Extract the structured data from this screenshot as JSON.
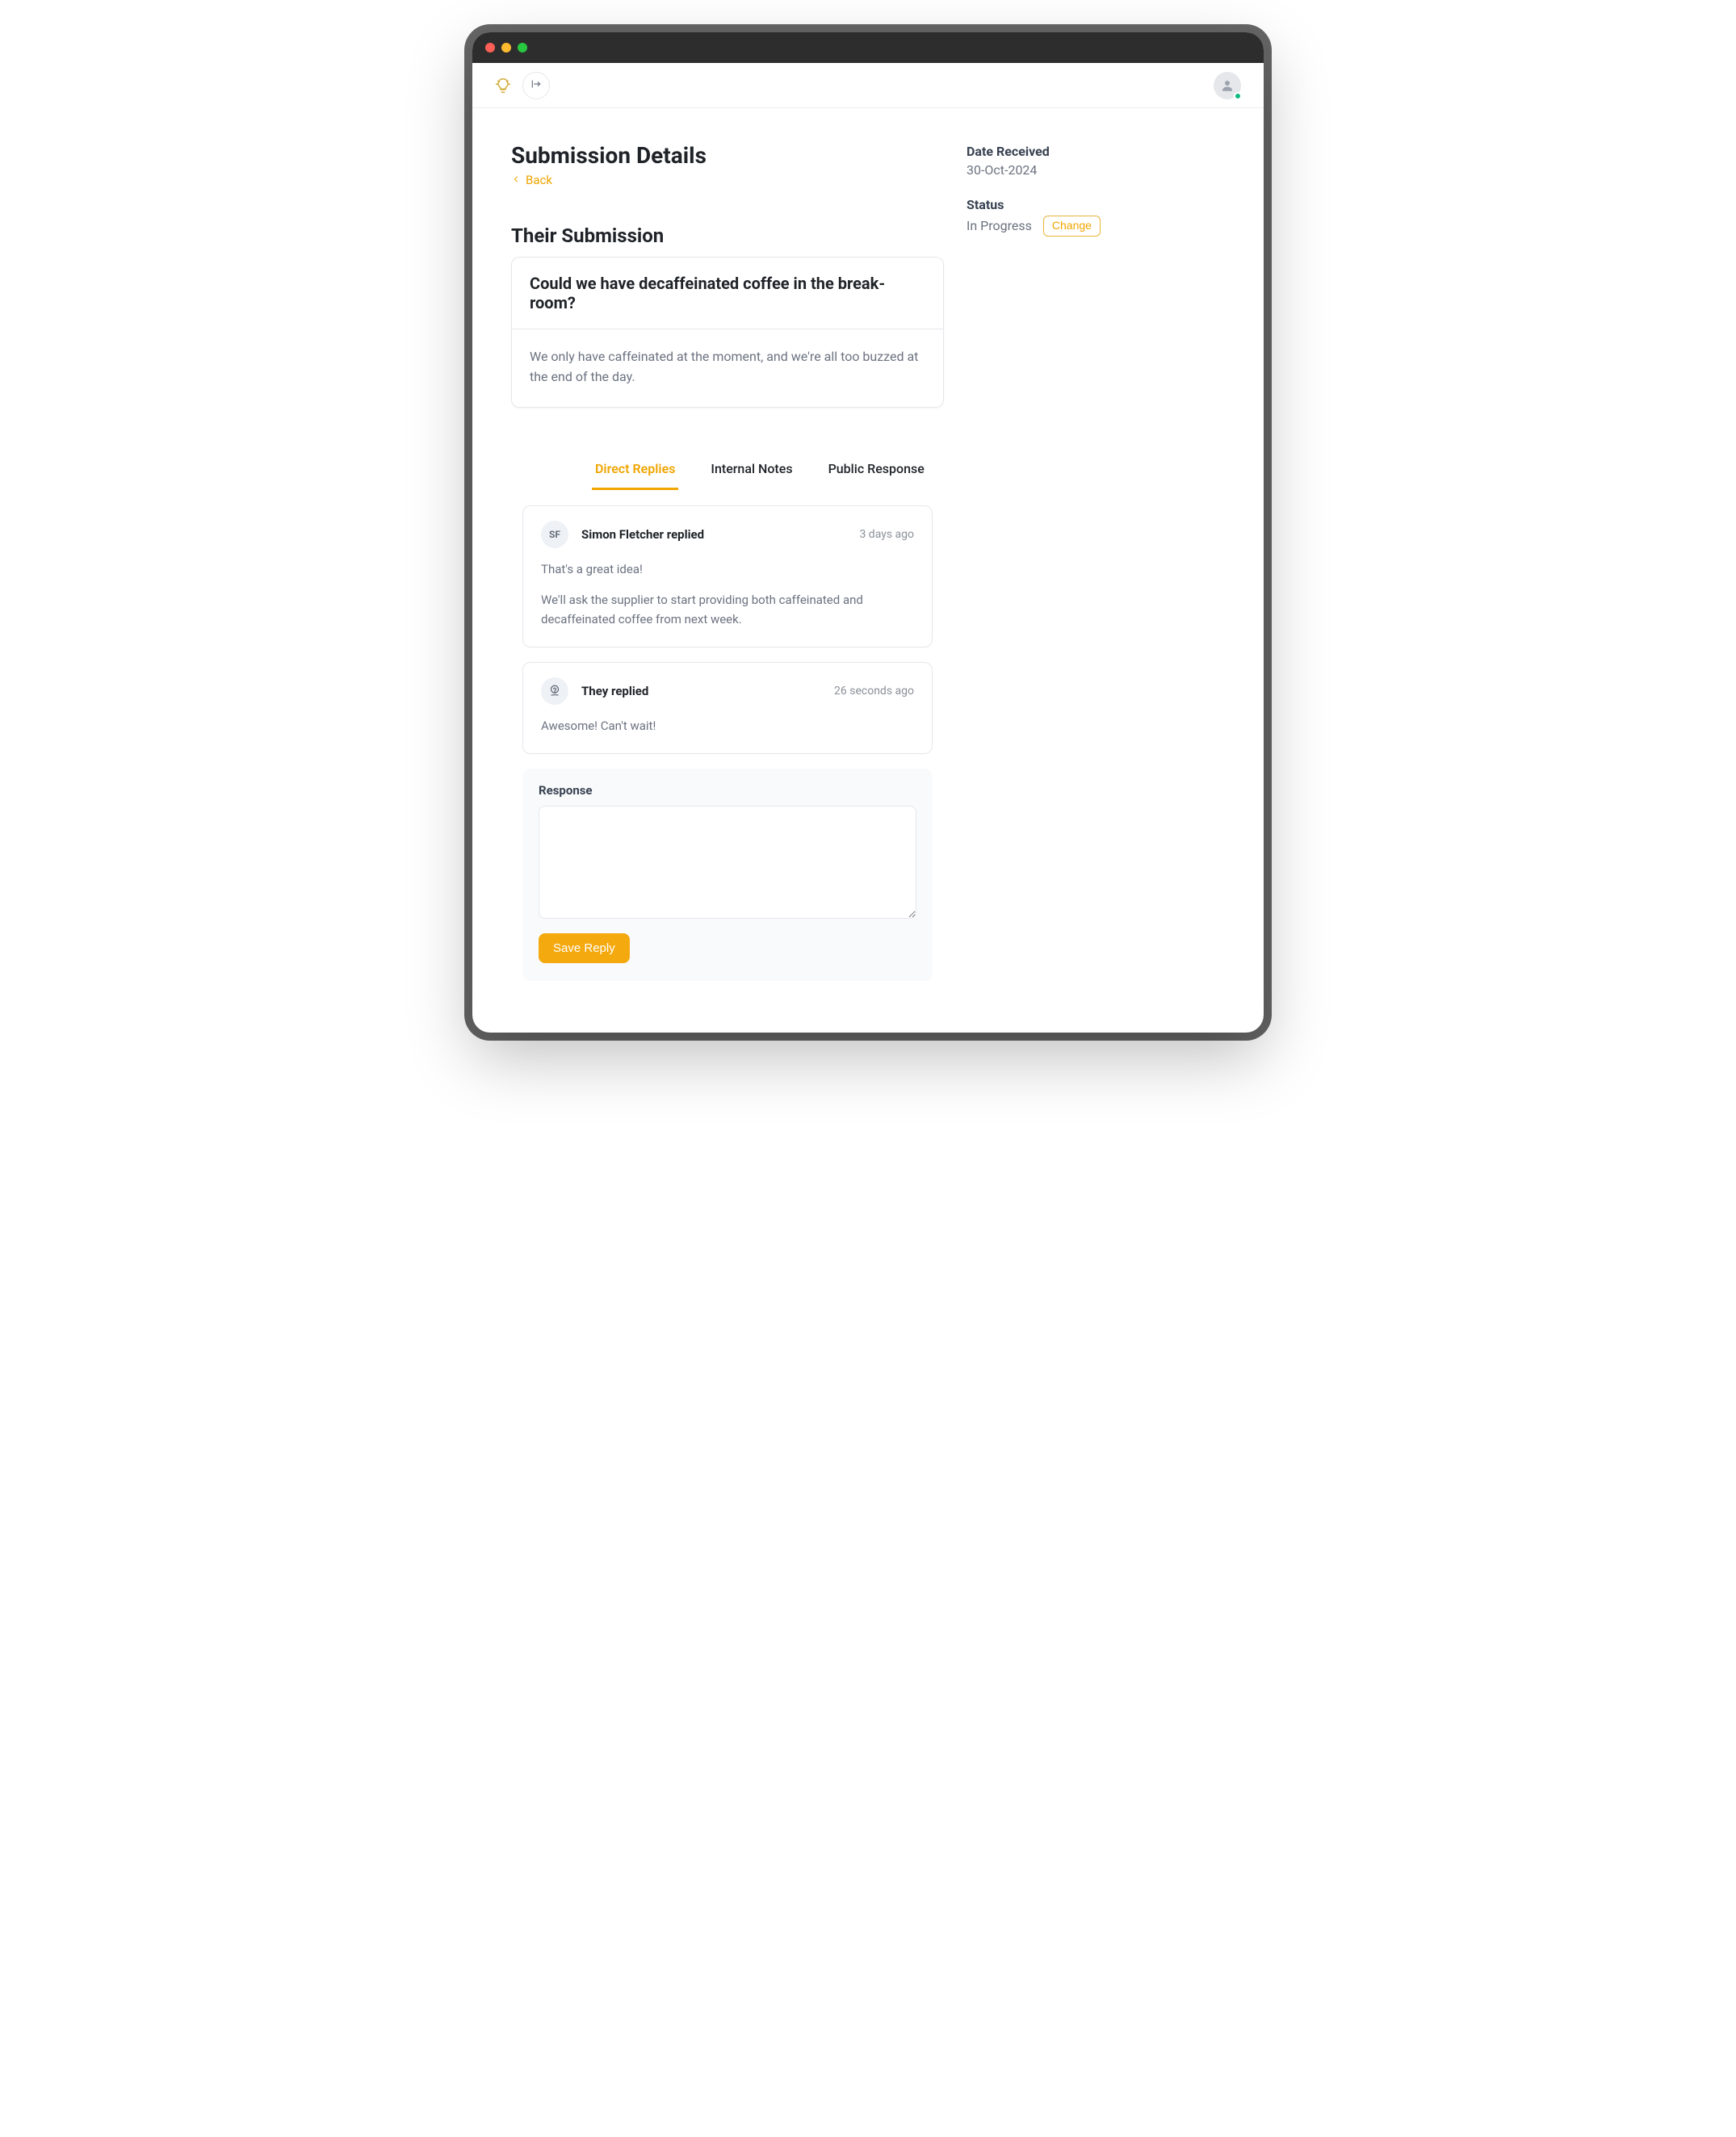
{
  "header": {
    "page_title": "Submission Details",
    "back_label": "Back"
  },
  "meta": {
    "date_label": "Date Received",
    "date_value": "30-Oct-2024",
    "status_label": "Status",
    "status_value": "In Progress",
    "change_label": "Change"
  },
  "submission": {
    "section_title": "Their Submission",
    "title": "Could we have decaffeinated coffee in the break-room?",
    "body": "We only have caffeinated at the moment, and we're all too buzzed at the end of the day."
  },
  "tabs": {
    "direct_replies": "Direct Replies",
    "internal_notes": "Internal Notes",
    "public_response": "Public Response"
  },
  "replies": {
    "0": {
      "avatar_initials": "SF",
      "who": "Simon Fletcher replied",
      "when": "3 days ago",
      "p1": "That's a great idea!",
      "p2": "We'll ask the supplier to start providing both caffeinated and decaffeinated coffee from next week."
    },
    "1": {
      "who": "They replied",
      "when": "26 seconds ago",
      "p1": "Awesome!  Can't wait!"
    }
  },
  "response_form": {
    "label": "Response",
    "save_label": "Save Reply"
  }
}
